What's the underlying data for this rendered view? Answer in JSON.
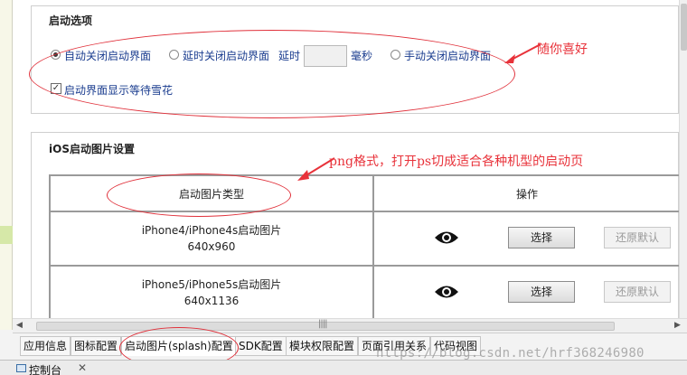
{
  "startup": {
    "title": "启动选项",
    "options": [
      {
        "label": "自动关闭启动界面",
        "checked": true
      },
      {
        "label": "延时关闭启动界面",
        "checked": false
      },
      {
        "label": "手动关闭启动界面",
        "checked": false
      }
    ],
    "delay_label": "延时",
    "delay_value": "",
    "delay_unit": "毫秒",
    "show_wait_label": "启动界面显示等待雪花",
    "show_wait_checked": true
  },
  "ios": {
    "title": "iOS启动图片设置",
    "col_type": "启动图片类型",
    "col_action": "操作",
    "rows": [
      {
        "name": "iPhone4/iPhone4s启动图片",
        "size": "640x960",
        "select": "选择",
        "reset": "还原默认"
      },
      {
        "name": "iPhone5/iPhone5s启动图片",
        "size": "640x1136",
        "select": "选择",
        "reset": "还原默认"
      }
    ]
  },
  "annotations": {
    "note1": "随你喜好",
    "note2": "png格式，打开ps切成适合各种机型的启动页"
  },
  "tabs": [
    {
      "label": "应用信息",
      "active": false
    },
    {
      "label": "图标配置",
      "active": false
    },
    {
      "label": "启动图片(splash)配置",
      "active": true
    },
    {
      "label": "SDK配置",
      "active": false
    },
    {
      "label": "模块权限配置",
      "active": false
    },
    {
      "label": "页面引用关系",
      "active": false
    },
    {
      "label": "代码视图",
      "active": false
    }
  ],
  "watermark": "https://blog.csdn.net/hrf368246980",
  "console": {
    "label": "控制台"
  },
  "colors": {
    "annotation": "#e0303a",
    "link_text": "#1a3c8f"
  }
}
